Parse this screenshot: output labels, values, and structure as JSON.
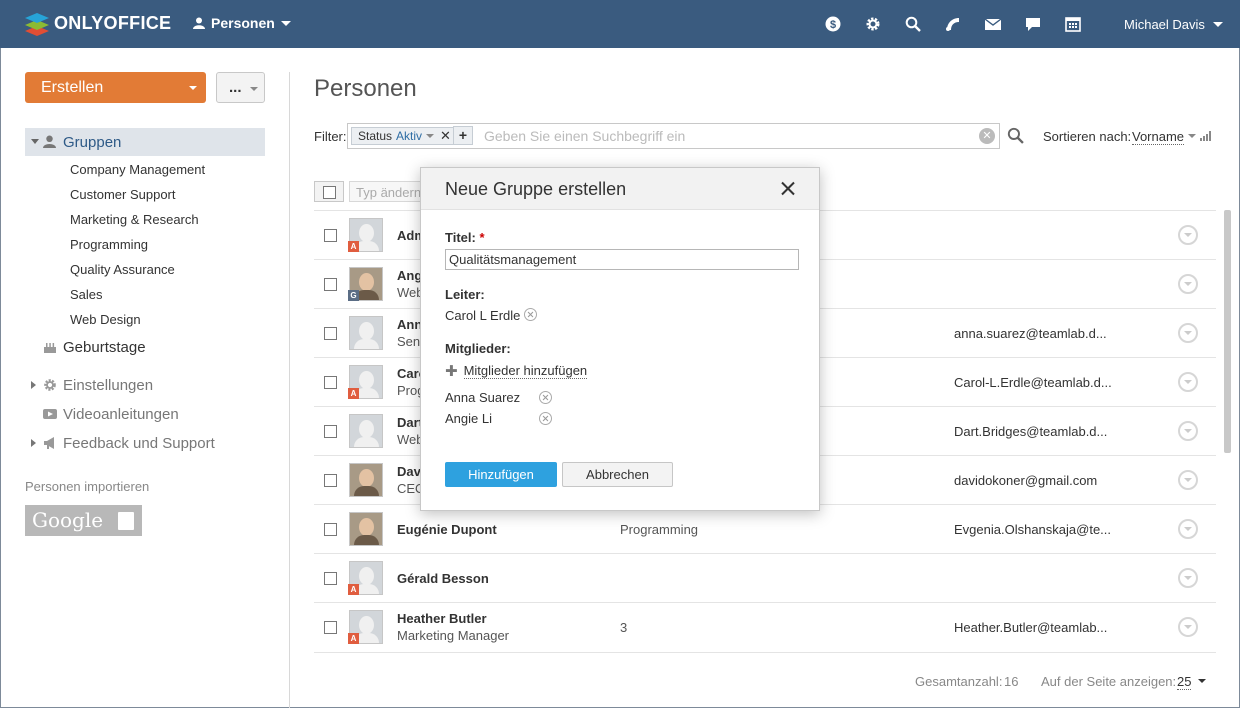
{
  "header": {
    "logo_text": "ONLYOFFICE",
    "module": "Personen",
    "user": "Michael Davis",
    "icons": [
      "dollar-icon",
      "gear-icon",
      "search-icon",
      "feed-icon",
      "mail-icon",
      "chat-icon",
      "calendar-icon"
    ]
  },
  "sidebar": {
    "create_label": "Erstellen",
    "more_label": "...",
    "groups_label": "Gruppen",
    "groups": [
      "Company Management",
      "Customer Support",
      "Marketing & Research",
      "Programming",
      "Quality Assurance",
      "Sales",
      "Web Design"
    ],
    "birthdays": "Geburtstage",
    "settings": "Einstellungen",
    "videos": "Videoanleitungen",
    "feedback": "Feedback und Support",
    "import_label": "Personen importieren",
    "google_label": "Google"
  },
  "main": {
    "title": "Personen",
    "filter_label": "Filter:",
    "chip_key": "Status",
    "chip_value": "Aktiv",
    "filter_placeholder": "Geben Sie einen Suchbegriff ein",
    "sort_label": "Sortieren nach:",
    "sort_value": "Vorname",
    "type_button": "Typ ändern"
  },
  "table": {
    "rows": [
      {
        "name": "Adm",
        "title": "",
        "dept": "",
        "email": "",
        "badge": "A"
      },
      {
        "name": "Ang",
        "title": "Web",
        "dept": "",
        "email": "",
        "badge": "G"
      },
      {
        "name": "Ann",
        "title": "Seni",
        "dept": "",
        "email": "anna.suarez@teamlab.d...",
        "badge": ""
      },
      {
        "name": "Caro",
        "title": "Prog",
        "dept": "",
        "email": "Carol-L.Erdle@teamlab.d...",
        "badge": "A"
      },
      {
        "name": "Dart",
        "title": "Web",
        "dept": "",
        "email": "Dart.Bridges@teamlab.d...",
        "badge": ""
      },
      {
        "name": "Davi",
        "title": "CEO",
        "dept": "",
        "email": "davidokoner@gmail.com",
        "badge": ""
      },
      {
        "name": "Eugénie Dupont",
        "title": "",
        "dept": "Programming",
        "email": "Evgenia.Olshanskaja@te...",
        "badge": ""
      },
      {
        "name": "Gérald Besson",
        "title": "",
        "dept": "",
        "email": "",
        "badge": "A"
      },
      {
        "name": "Heather Butler",
        "title": "Marketing Manager",
        "dept": "3",
        "email": "Heather.Butler@teamlab...",
        "badge": "A"
      }
    ]
  },
  "footer": {
    "total_label": "Gesamtanzahl:",
    "total_value": "16",
    "per_page_label": "Auf der Seite anzeigen:",
    "per_page_value": "25"
  },
  "dialog": {
    "title": "Neue Gruppe erstellen",
    "title_label": "Titel:",
    "title_required": "*",
    "title_value": "Qualitätsmanagement",
    "leader_label": "Leiter:",
    "leader": "Carol L Erdle",
    "members_label": "Mitglieder:",
    "add_members": "Mitglieder hinzufügen",
    "members": [
      "Anna Suarez",
      "Angie Li"
    ],
    "ok": "Hinzufügen",
    "cancel": "Abbrechen"
  },
  "colors": {
    "topbar": "#3a5b7f",
    "create": "#e27b36",
    "primary": "#2ea1df",
    "badge_admin": "#e05d3f",
    "badge_guest": "#5b6d85"
  }
}
